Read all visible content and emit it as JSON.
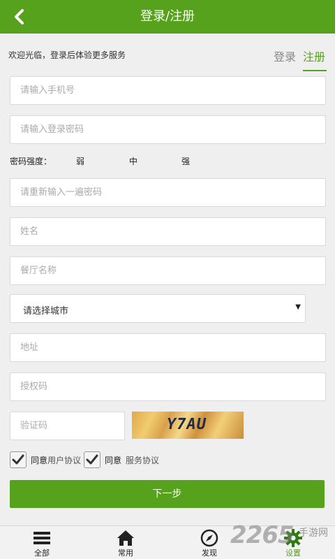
{
  "header": {
    "title": "登录/注册",
    "back_icon": "chevron-left-icon"
  },
  "welcome": {
    "text": "欢迎光临，登录后体验更多服务",
    "tab_login": "登录",
    "tab_register": "注册"
  },
  "form": {
    "phone_placeholder": "请输入手机号",
    "password_placeholder": "请输入登录密码",
    "strength": {
      "label": "密码强度：",
      "weak": "弱",
      "medium": "中",
      "strong": "强"
    },
    "confirm_password_placeholder": "请重新输入一遍密码",
    "name_placeholder": "姓名",
    "restaurant_placeholder": "餐厅名称",
    "city_select": {
      "value": "请选择城市",
      "caret": "▼"
    },
    "address_placeholder": "地址",
    "auth_code_placeholder": "授权码",
    "captcha_placeholder": "验证码",
    "captcha_text": "Y7AU"
  },
  "agreements": {
    "user": {
      "agree": "同意",
      "link": "用户协议",
      "checked": true
    },
    "service": {
      "agree": "同意",
      "link": "服务协议",
      "checked": true
    }
  },
  "next_button": "下一步",
  "bottom_nav": {
    "items": [
      {
        "label": "全部",
        "icon": "menu-icon"
      },
      {
        "label": "常用",
        "icon": "home-icon"
      },
      {
        "label": "发现",
        "icon": "compass-icon"
      },
      {
        "label": "设置",
        "icon": "gear-icon",
        "active": true
      }
    ]
  },
  "watermark": {
    "num": "2265",
    "cn": "手游网"
  },
  "colors": {
    "brand": "#57a21d",
    "background": "#efefef"
  }
}
